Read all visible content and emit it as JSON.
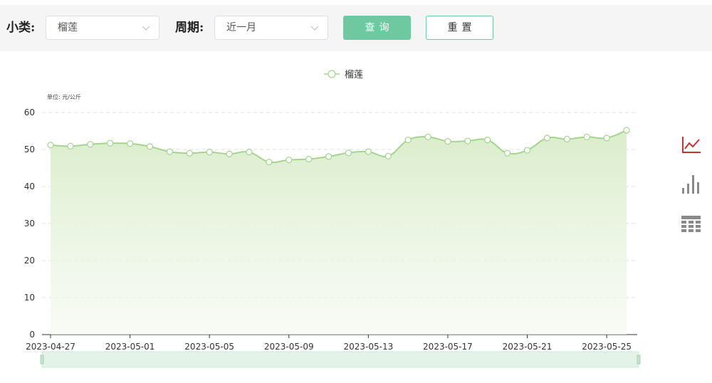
{
  "filters": {
    "category_label": "小类:",
    "category_value": "榴莲",
    "period_label": "周期:",
    "period_value": "近一月"
  },
  "buttons": {
    "query": "查询",
    "reset": "重置"
  },
  "colors": {
    "series_line": "#a3d58e",
    "accent_green": "#6ec9a0",
    "active_icon": "#c23531",
    "inactive_icon": "#8a8a8a"
  },
  "toolbox": [
    "line-chart-icon",
    "bar-chart-icon",
    "data-table-icon"
  ],
  "chart_data": {
    "type": "line",
    "unit_label": "单位: 元/公斤",
    "legend_position": "top-center",
    "area_fill": true,
    "smooth": true,
    "grid_horizontal": true,
    "ylim": [
      0,
      60
    ],
    "yticks": [
      0,
      10,
      20,
      30,
      40,
      50,
      60
    ],
    "x": [
      "2023-04-27",
      "2023-04-28",
      "2023-04-29",
      "2023-04-30",
      "2023-05-01",
      "2023-05-02",
      "2023-05-03",
      "2023-05-04",
      "2023-05-05",
      "2023-05-06",
      "2023-05-07",
      "2023-05-08",
      "2023-05-09",
      "2023-05-10",
      "2023-05-11",
      "2023-05-12",
      "2023-05-13",
      "2023-05-14",
      "2023-05-15",
      "2023-05-16",
      "2023-05-17",
      "2023-05-18",
      "2023-05-19",
      "2023-05-20",
      "2023-05-21",
      "2023-05-22",
      "2023-05-23",
      "2023-05-24",
      "2023-05-25",
      "2023-05-26"
    ],
    "xtick_labels": [
      "2023-04-27",
      "2023-05-01",
      "2023-05-05",
      "2023-05-09",
      "2023-05-13",
      "2023-05-17",
      "2023-05-21",
      "2023-05-25"
    ],
    "series": [
      {
        "name": "榴莲",
        "values": [
          51.2,
          50.9,
          51.4,
          51.7,
          51.6,
          50.8,
          49.4,
          49.0,
          49.3,
          48.8,
          49.3,
          46.6,
          47.2,
          47.4,
          48.1,
          49.1,
          49.4,
          48.2,
          52.6,
          53.4,
          52.2,
          52.3,
          52.6,
          49.0,
          49.8,
          53.1,
          52.8,
          53.4,
          53.1,
          55.2
        ]
      }
    ]
  }
}
